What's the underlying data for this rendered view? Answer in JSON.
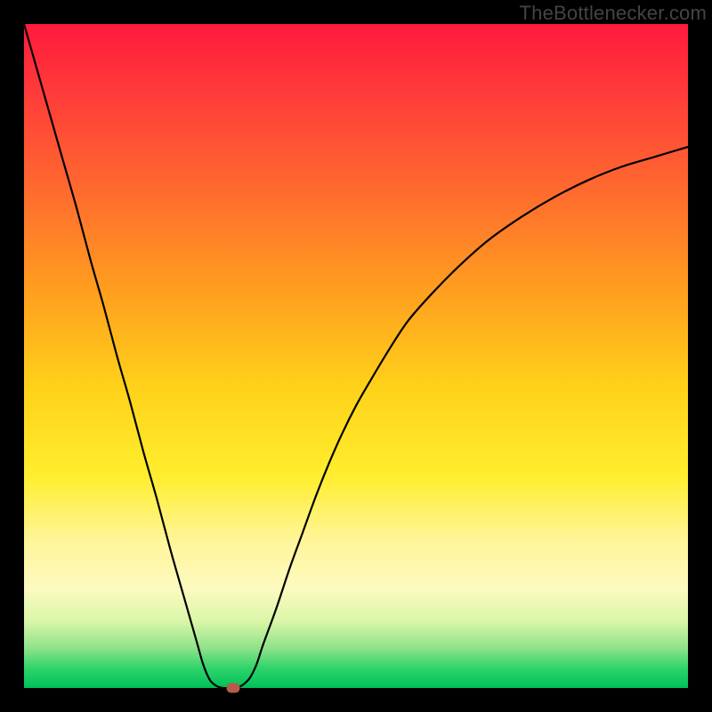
{
  "watermark": "TheBottlenecker.com",
  "chart_data": {
    "type": "line",
    "title": "",
    "xlabel": "",
    "ylabel": "",
    "xlim": [
      0,
      100
    ],
    "ylim": [
      0,
      100
    ],
    "x": [
      0,
      2,
      4,
      6,
      8,
      10,
      12,
      14,
      16,
      18,
      20,
      22,
      24,
      26,
      27,
      28,
      29,
      30,
      31,
      32,
      33,
      34,
      35,
      36,
      38,
      40,
      42,
      44,
      46,
      48,
      50,
      52,
      55,
      58,
      62,
      66,
      70,
      75,
      80,
      85,
      90,
      95,
      100
    ],
    "values": [
      100,
      93,
      86,
      79,
      72,
      64.5,
      57.5,
      50,
      43,
      35.5,
      28.5,
      21,
      14,
      7,
      3.5,
      1.2,
      0.3,
      0.0,
      0.0,
      0.0,
      0.5,
      1.5,
      3.5,
      6.5,
      12,
      18,
      23.5,
      29,
      34,
      38.5,
      42.5,
      46,
      51,
      55.5,
      60,
      64,
      67.5,
      71,
      74,
      76.5,
      78.5,
      80,
      81.5
    ],
    "marker": {
      "x": 31.5,
      "y": 0
    },
    "background_gradient": [
      "#ff1a3c",
      "#ff9e1f",
      "#ffee2e",
      "#00c05a"
    ]
  }
}
